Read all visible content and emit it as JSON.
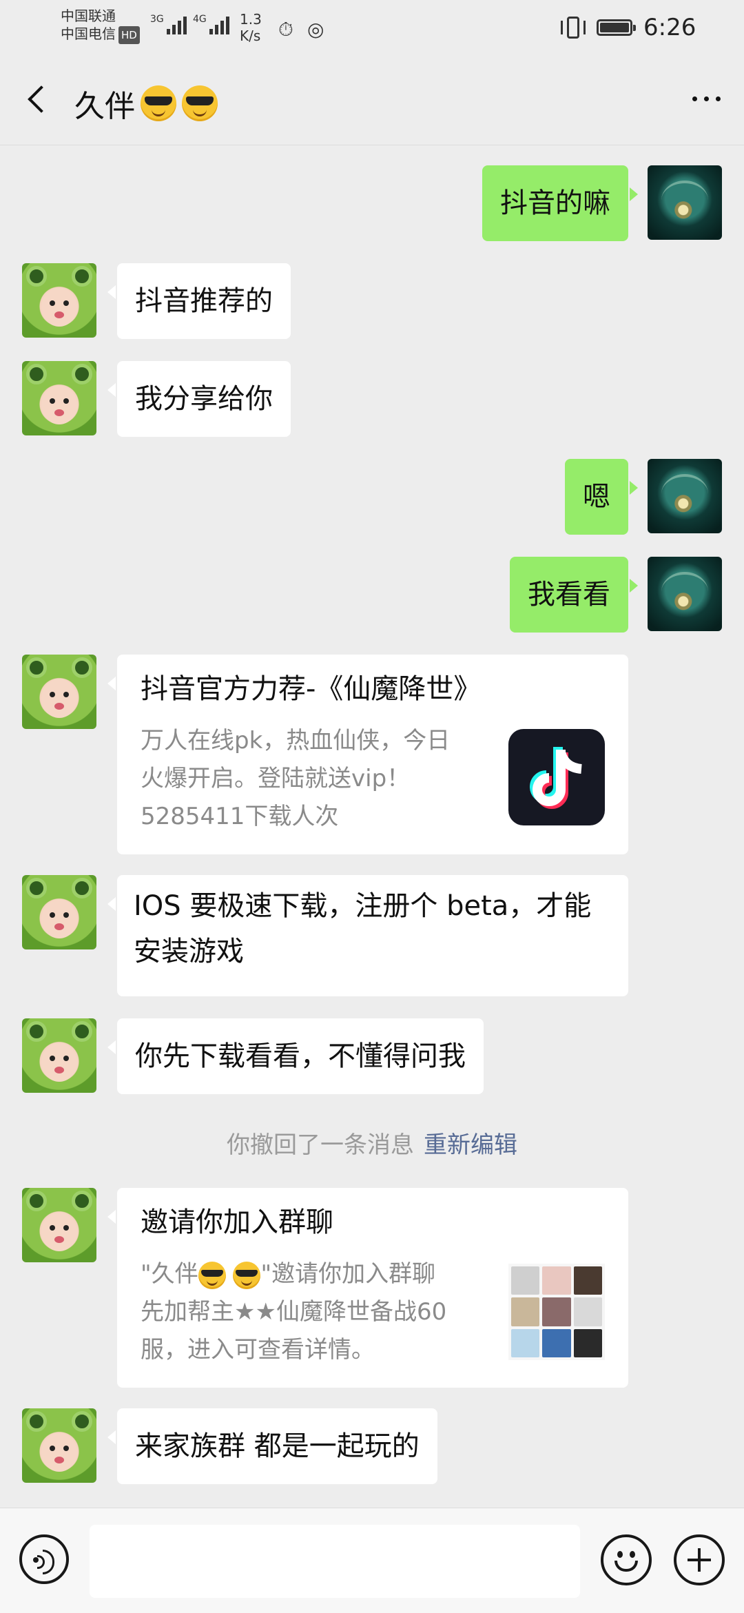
{
  "status_bar": {
    "carrier1": "中国联通",
    "carrier2": "中国电信",
    "hd": "HD",
    "net1": "3G",
    "net2": "4G",
    "speed_value": "1.3",
    "speed_unit": "K/s",
    "time": "6:26",
    "battery_level": 1.0
  },
  "header": {
    "title": "久伴",
    "title_emoji": "cool-sunglasses-emoji"
  },
  "messages": [
    {
      "side": "out",
      "text": "抖音的嘛"
    },
    {
      "side": "in",
      "text": "抖音推荐的"
    },
    {
      "side": "in",
      "text": "我分享给你"
    },
    {
      "side": "out",
      "text": "嗯"
    },
    {
      "side": "out",
      "text": "我看看"
    },
    {
      "side": "in",
      "type": "card",
      "title": "抖音官方力荐-《仙魔降世》",
      "desc": "万人在线pk，热血仙侠，今日火爆开启。登陆就送vip！5285411下载人次",
      "thumb_icon": "tiktok-logo-icon"
    },
    {
      "side": "in",
      "text": "IOS 要极速下载，注册个 beta，才能安装游戏"
    },
    {
      "side": "in",
      "text": "你先下载看看，不懂得问我"
    },
    {
      "type": "system",
      "text": "你撤回了一条消息",
      "link": "重新编辑"
    },
    {
      "side": "in",
      "type": "card",
      "title": "邀请你加入群聊",
      "desc_prefix": "\"久伴",
      "desc_suffix": "\"邀请你加入群聊先加帮主★★仙魔降世备战60服，进入可查看详情。",
      "thumb_icon": "group-avatar-grid"
    },
    {
      "side": "in",
      "text": "来家族群 都是一起玩的"
    }
  ],
  "input": {
    "placeholder": ""
  },
  "colors": {
    "background": "#ededed",
    "bubble_out": "#95ec69",
    "bubble_in": "#ffffff",
    "link": "#576b95"
  }
}
